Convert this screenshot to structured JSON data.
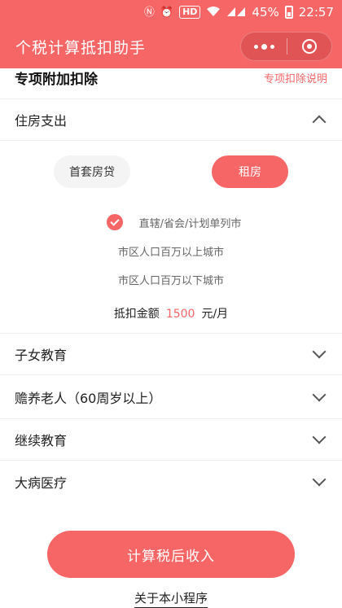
{
  "status_bar": {
    "battery": "45%",
    "time": "22:57",
    "hd_badge": "HD",
    "nfc_icon": "nfc-icon",
    "alarm_icon": "alarm-icon",
    "wifi_icon": "wifi-icon",
    "signal_icon": "signal-icon"
  },
  "header": {
    "title": "个税计算抵扣助手",
    "more_icon": "more-dots-icon",
    "close_icon": "mini-program-close-icon"
  },
  "section": {
    "title": "专项附加扣除",
    "link": "专项扣除说明"
  },
  "housing": {
    "label": "住房支出",
    "options": {
      "mortgage": "首套房贷",
      "rent": "租房",
      "selected": "rent"
    },
    "city_options": [
      "直辖/省会/计划单列市",
      "市区人口百万以上城市",
      "市区人口百万以下城市"
    ],
    "selected_city_index": 0,
    "amount_label": "抵扣金额",
    "amount_value": "1500",
    "amount_unit": "元/月"
  },
  "categories": [
    {
      "label": "子女教育"
    },
    {
      "label": "赡养老人（60周岁以上）"
    },
    {
      "label": "继续教育"
    },
    {
      "label": "大病医疗"
    }
  ],
  "actions": {
    "calculate": "计算税后收入",
    "about": "关于本小程序"
  },
  "colors": {
    "accent": "#f76667",
    "divider": "#eeeeee"
  }
}
